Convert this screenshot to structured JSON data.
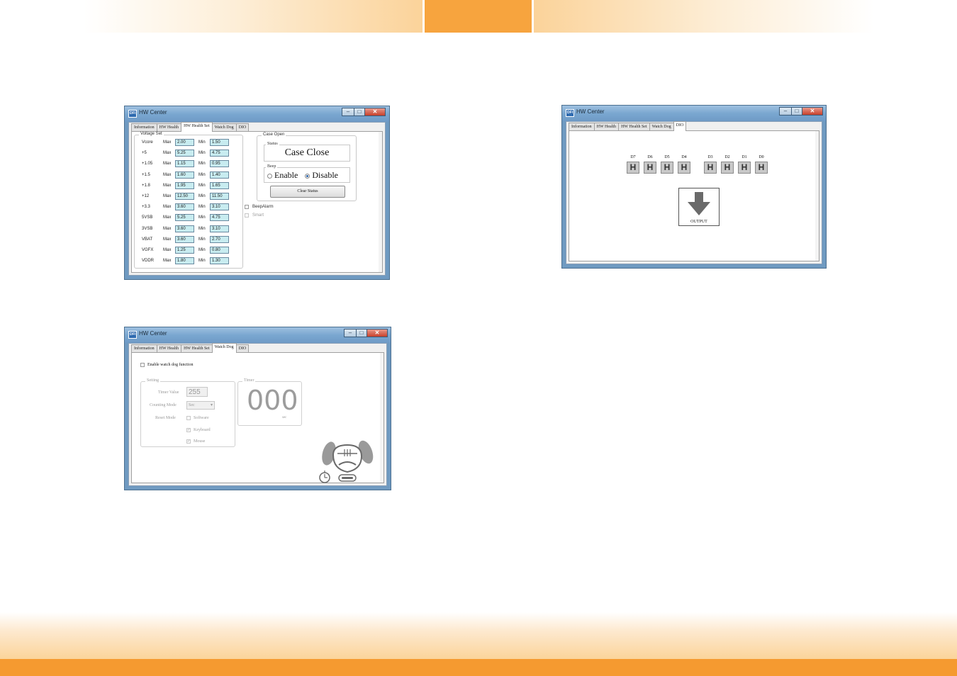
{
  "windows": {
    "health_set": {
      "title": "HW Center",
      "tabs": [
        "Information",
        "HW Health",
        "HW Health Set",
        "Watch Dog",
        "DIO"
      ],
      "active_tab": "HW Health Set",
      "voltage_set": {
        "legend": "Voltage Set",
        "max_label": "Max",
        "min_label": "Min",
        "rows": [
          {
            "name": "Vcore",
            "max": "2.00",
            "min": "1.50"
          },
          {
            "name": "+5",
            "max": "5.25",
            "min": "4.75"
          },
          {
            "name": "+1.05",
            "max": "1.15",
            "min": "0.95"
          },
          {
            "name": "+1.5",
            "max": "1.60",
            "min": "1.40"
          },
          {
            "name": "+1.8",
            "max": "1.95",
            "min": "1.65"
          },
          {
            "name": "+12",
            "max": "12.50",
            "min": "11.50"
          },
          {
            "name": "+3.3",
            "max": "3.60",
            "min": "3.10"
          },
          {
            "name": "5VSB",
            "max": "5.25",
            "min": "4.75"
          },
          {
            "name": "3VSB",
            "max": "3.60",
            "min": "3.10"
          },
          {
            "name": "VBAT",
            "max": "3.60",
            "min": "2.70"
          },
          {
            "name": "VGFX",
            "max": "1.25",
            "min": "0.80"
          },
          {
            "name": "VDDR",
            "max": "1.80",
            "min": "1.30"
          }
        ]
      },
      "case_open": {
        "legend": "Case Open",
        "status_label": "Status",
        "status_value": "Case Close",
        "beep_label": "Beep",
        "enable_label": "Enable",
        "disable_label": "Disable",
        "beep_selected": "Disable",
        "clear_button": "Clear Status"
      },
      "beep_alarm_label": "BeepAlarm",
      "smart_label": "Smart"
    },
    "dio": {
      "title": "HW Center",
      "tabs": [
        "Information",
        "HW Health",
        "HW Health Set",
        "Watch Dog",
        "DIO"
      ],
      "active_tab": "DIO",
      "pins": [
        {
          "label": "D7",
          "value": "H"
        },
        {
          "label": "D6",
          "value": "H"
        },
        {
          "label": "D5",
          "value": "H"
        },
        {
          "label": "D4",
          "value": "H"
        },
        {
          "label": "D3",
          "value": "H"
        },
        {
          "label": "D2",
          "value": "H"
        },
        {
          "label": "D1",
          "value": "H"
        },
        {
          "label": "D0",
          "value": "H"
        }
      ],
      "direction_label": "OUTPUT"
    },
    "watchdog": {
      "title": "HW Center",
      "tabs": [
        "Information",
        "HW Health",
        "HW Health Set",
        "Watch Dog",
        "DIO"
      ],
      "active_tab": "Watch Dog",
      "enable_label": "Enable watch dog function",
      "setting": {
        "legend": "Setting",
        "timer_value_label": "Timer Value",
        "timer_value": "255",
        "counting_mode_label": "Counting Mode",
        "counting_mode_value": "Sec",
        "reset_mode_label": "Reset Mode",
        "software_label": "Software",
        "keyboard_label": "Keyboard",
        "mouse_label": "Mouse"
      },
      "timer": {
        "legend": "Timer",
        "value": "000",
        "unit": "sec"
      }
    }
  },
  "colors": {
    "accent_orange": "#f59a30",
    "field_cyan": "#c8ecf0"
  }
}
